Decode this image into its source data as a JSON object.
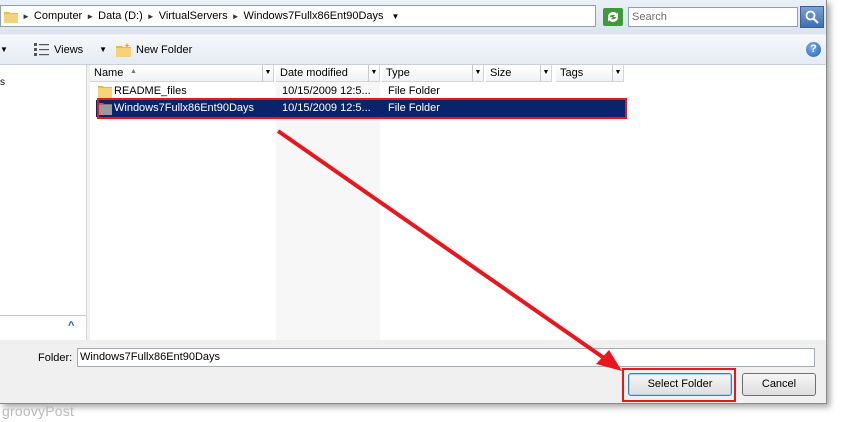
{
  "address_bar": {
    "segments": [
      "Computer",
      "Data (D:)",
      "VirtualServers",
      "Windows7Fullx86Ent90Days"
    ]
  },
  "search": {
    "placeholder": "Search"
  },
  "toolbar": {
    "views_label": "Views",
    "new_folder_label": "New Folder",
    "help_label": "?"
  },
  "nav": {
    "partial_text": "s",
    "scroll_up": "^"
  },
  "columns": [
    "Name",
    "Date modified",
    "Type",
    "Size",
    "Tags"
  ],
  "rows": [
    {
      "name": "README_files",
      "date": "10/15/2009 12:5...",
      "type": "File Folder",
      "selected": false
    },
    {
      "name": "Windows7Fullx86Ent90Days",
      "date": "10/15/2009 12:5...",
      "type": "File Folder",
      "selected": true
    }
  ],
  "folder_field": {
    "label": "Folder:",
    "value": "Windows7Fullx86Ent90Days"
  },
  "buttons": {
    "select_folder": "Select Folder",
    "cancel": "Cancel"
  },
  "watermark": "groovyPost",
  "colors": {
    "selection": "#0a246a",
    "annotation_red": "#e8171e",
    "folder_yellow": "#f1c95b"
  },
  "icons": [
    "folder-icon",
    "refresh-icon",
    "search-icon",
    "views-icon",
    "new-folder-icon",
    "help-icon",
    "arrow-annotation"
  ]
}
